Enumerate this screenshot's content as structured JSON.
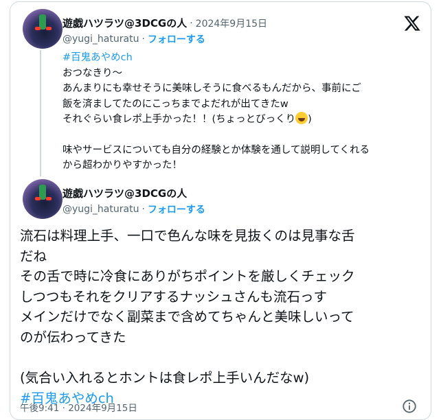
{
  "post1": {
    "author_name": "遊戯ハツラツ@3DCGの人",
    "date": "2024年9月15日",
    "handle": "@yugi_haturatu",
    "follow_label": "フォローする",
    "hashtag": "#百鬼あやめch",
    "lines": [
      "おつなきり～",
      "あんまりにも幸せそうに美味しそうに食べるもんだから、事前にご",
      "飯を済ましてたのにこっちまでよだれが出てきたw",
      "それぐらい食レポ上手かった！！(ちょっとびっくり",
      ")",
      "味やサービスについても自分の経験とか体験を通して説明してくれる",
      "から超わかりやすかった！"
    ],
    "emoji_name": "rolling-on-floor-laughing"
  },
  "post2": {
    "author_name": "遊戯ハツラツ@3DCGの人",
    "handle": "@yugi_haturatu",
    "follow_label": "フォローする",
    "lines": [
      "流石は料理上手、一口で色んな味を見抜くのは見事な舌",
      "だね",
      "その舌で時に冷食にありがちポイントを厳しくチェック",
      "しつつもそれをクリアするナッシュさんも流石っす",
      "メインだけでなく副菜まで含めてちゃんと美味しいって",
      "のが伝わってきた",
      "(気合い入れるとホントは食レポ上手いんだなw)"
    ],
    "hashtag": "#百鬼あやめch",
    "time": "午後9:41",
    "date": "2024年9月15日"
  },
  "icons": {
    "brand": "x-logo-icon",
    "info": "info-icon"
  },
  "colors": {
    "accent": "#1d9bf0",
    "text": "#0f1419",
    "muted": "#536471",
    "border": "#cfd9de"
  },
  "separator": "·"
}
